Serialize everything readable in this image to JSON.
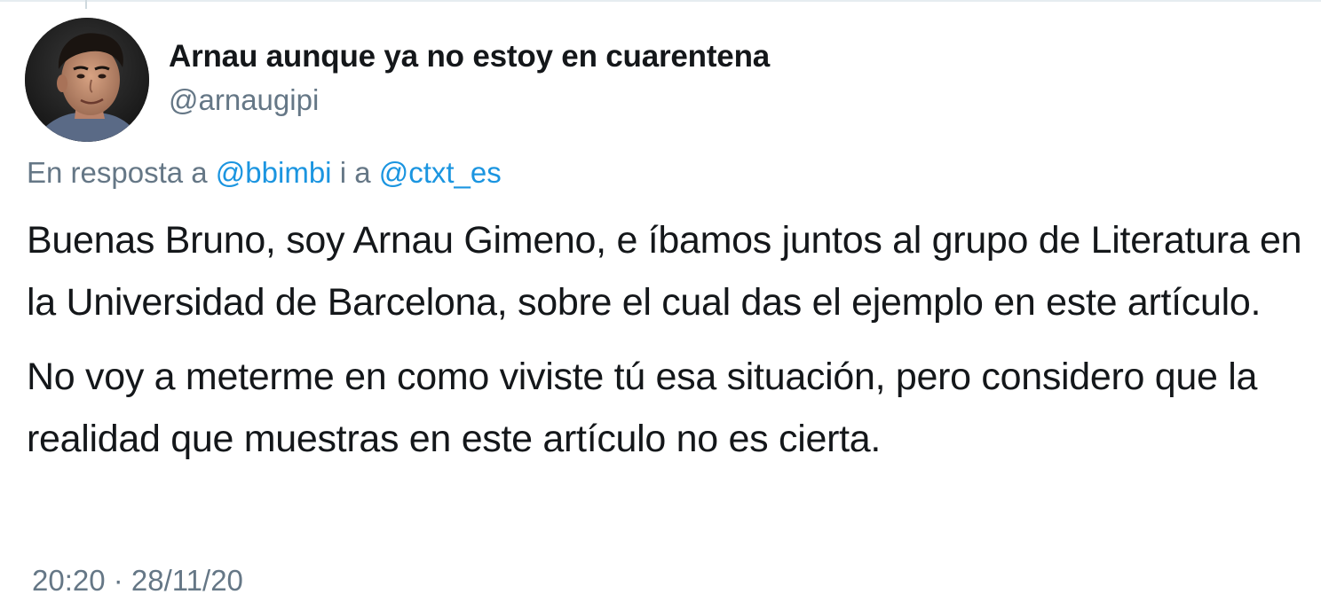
{
  "author": {
    "display_name": "Arnau aunque ya no estoy en cuarentena",
    "handle": "@arnaugipi"
  },
  "reply": {
    "prefix": "En resposta a",
    "mention_1": "@bbimbi",
    "connector": "i a",
    "mention_2": "@ctxt_es"
  },
  "tweet": {
    "paragraph_1": "Buenas Bruno, soy Arnau Gimeno, e íbamos juntos al grupo de Literatura en la Universidad de Barcelona, sobre el cual das el ejemplo en este artículo.",
    "paragraph_2": "No voy a meterme en como viviste tú esa situación, pero considero que la realidad que muestras en este artículo no es cierta.",
    "timestamp": "20:20 · 28/11/20"
  },
  "colors": {
    "text": "#14171a",
    "secondary": "#657786",
    "mention": "#1b95e0",
    "divider": "#e6ecf0"
  },
  "icons": {
    "avatar": "profile-photo"
  }
}
